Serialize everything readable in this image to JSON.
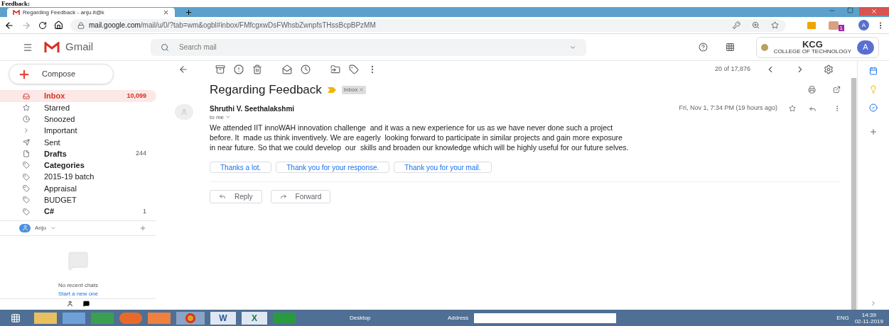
{
  "document_heading": "Feedback:",
  "browser": {
    "tab_title": "Regarding Feedback - anju.it@k",
    "url_host": "mail.google.com",
    "url_path": "/mail/u/0/?tab=wm&ogbl#inbox/FMfcgxwDsFWhsbZwnpfsTHssBcpBPzMM",
    "profile_initial": "A",
    "extension_badge": "1"
  },
  "gmail": {
    "brand": "Gmail",
    "search": {
      "placeholder": "Search mail"
    },
    "org_logo": "KCG",
    "org_subtitle": "COLLEGE OF TECHNOLOGY",
    "account_initial": "A"
  },
  "compose": "Compose",
  "sidebar": {
    "items": [
      {
        "label": "Inbox",
        "count": "10,099",
        "bold": true,
        "selected": true
      },
      {
        "label": "Starred",
        "bold": false,
        "selected": false
      },
      {
        "label": "Snoozed",
        "bold": false,
        "selected": false
      },
      {
        "label": "Important",
        "bold": false,
        "selected": false
      },
      {
        "label": "Sent",
        "bold": false,
        "selected": false
      },
      {
        "label": "Drafts",
        "count": "244",
        "bold": true,
        "selected": false
      },
      {
        "label": "Categories",
        "bold": true,
        "selected": false
      },
      {
        "label": "2015-19 batch",
        "bold": false,
        "selected": false
      },
      {
        "label": "Appraisal",
        "bold": false,
        "selected": false
      },
      {
        "label": "BUDGET",
        "bold": false,
        "selected": false
      },
      {
        "label": "C#",
        "count": "1",
        "bold": true,
        "selected": false
      }
    ]
  },
  "hangouts": {
    "user": "Anju",
    "empty_title": "No recent chats",
    "empty_link": "Start a new one"
  },
  "toolbar": {
    "pager": "20 of 17,876"
  },
  "message": {
    "subject": "Regarding Feedback",
    "label": "Inbox",
    "sender": "Shruthi V. Seethalakshmi",
    "recipient": "to me",
    "date": "Fri, Nov 1, 7:34 PM (19 hours ago)",
    "body": [
      "We attended IIT innoWAH innovation challenge  and it was a new experience for us as we have never done such a project",
      "before. It  made us think inventively. We are eagerly  looking forward to participate in similar projects and gain more exposure",
      "in near future. So that we could develop  our  skills and broaden our knowledge which will be highly useful for our future selves."
    ],
    "smart_replies": [
      "Thanks a lot.",
      "Thank you for your response.",
      "Thank you for your mail."
    ],
    "actions": [
      "Reply",
      "Forward"
    ]
  },
  "taskbar": {
    "word_label": "W",
    "excel_label": "X",
    "desktop": "Desktop",
    "address": "Address",
    "language": "ENG",
    "time": "14:39",
    "date": "02-11-2019"
  }
}
